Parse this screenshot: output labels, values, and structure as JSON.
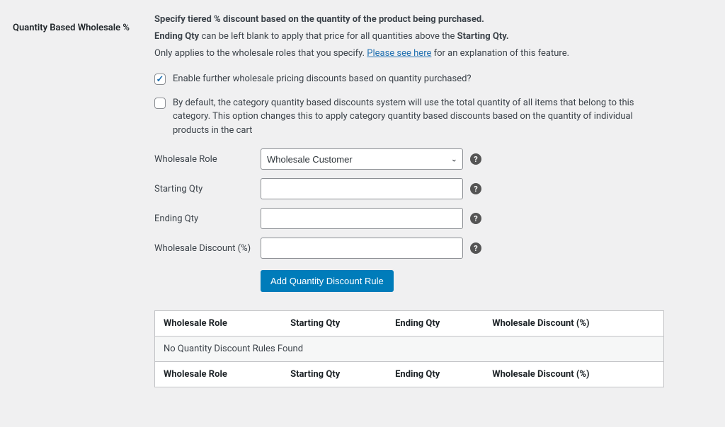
{
  "section": {
    "title": "Quantity Based Wholesale %",
    "desc_bold": "Specify tiered % discount based on the quantity of the product being purchased.",
    "desc_line2_a": "Ending Qty",
    "desc_line2_b": " can be left blank to apply that price for all quantities above the ",
    "desc_line2_c": "Starting Qty.",
    "desc_line3_a": "Only applies to the wholesale roles that you specify. ",
    "desc_link": "Please see here",
    "desc_line3_b": " for an explanation of this feature."
  },
  "enable": {
    "checked": true,
    "label": "Enable further wholesale pricing discounts based on quantity purchased?"
  },
  "perProduct": {
    "checked": false,
    "label": "By default, the category quantity based discounts system will use the total quantity of all items that belong to this category. This option changes this to apply category quantity based discounts based on the quantity of individual products in the cart"
  },
  "form": {
    "role_label": "Wholesale Role",
    "role_value": "Wholesale Customer",
    "starting_label": "Starting Qty",
    "starting_value": "",
    "ending_label": "Ending Qty",
    "ending_value": "",
    "discount_label": "Wholesale Discount (%)",
    "discount_value": "",
    "add_button": "Add Quantity Discount Rule"
  },
  "table": {
    "col1": "Wholesale Role",
    "col2": "Starting Qty",
    "col3": "Ending Qty",
    "col4": "Wholesale Discount (%)",
    "empty": "No Quantity Discount Rules Found"
  },
  "help": "?"
}
